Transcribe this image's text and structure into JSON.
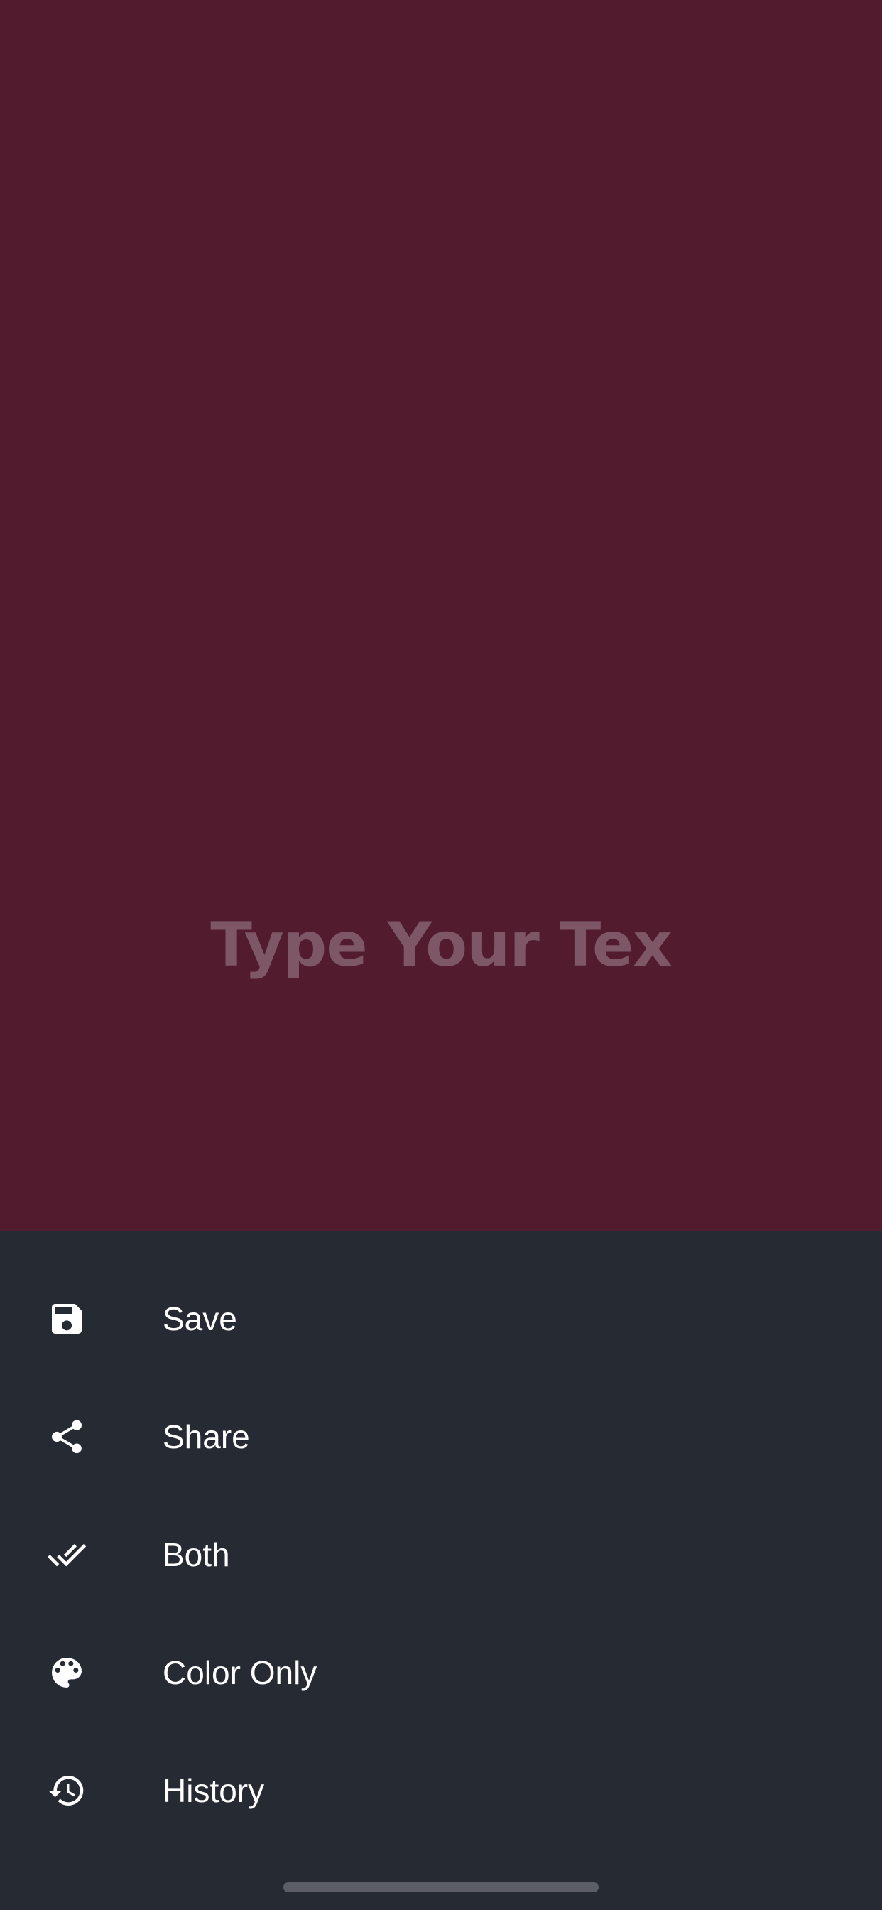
{
  "canvas": {
    "placeholder_text": "Type Your Tex",
    "background_color": "#521b2e",
    "text_color": "#7d5766"
  },
  "sheet": {
    "background_color": "#262a33",
    "items": [
      {
        "label": "Save",
        "icon": "save-icon"
      },
      {
        "label": "Share",
        "icon": "share-icon"
      },
      {
        "label": "Both",
        "icon": "double-check-icon"
      },
      {
        "label": "Color Only",
        "icon": "palette-icon"
      },
      {
        "label": "History",
        "icon": "history-icon"
      }
    ]
  }
}
